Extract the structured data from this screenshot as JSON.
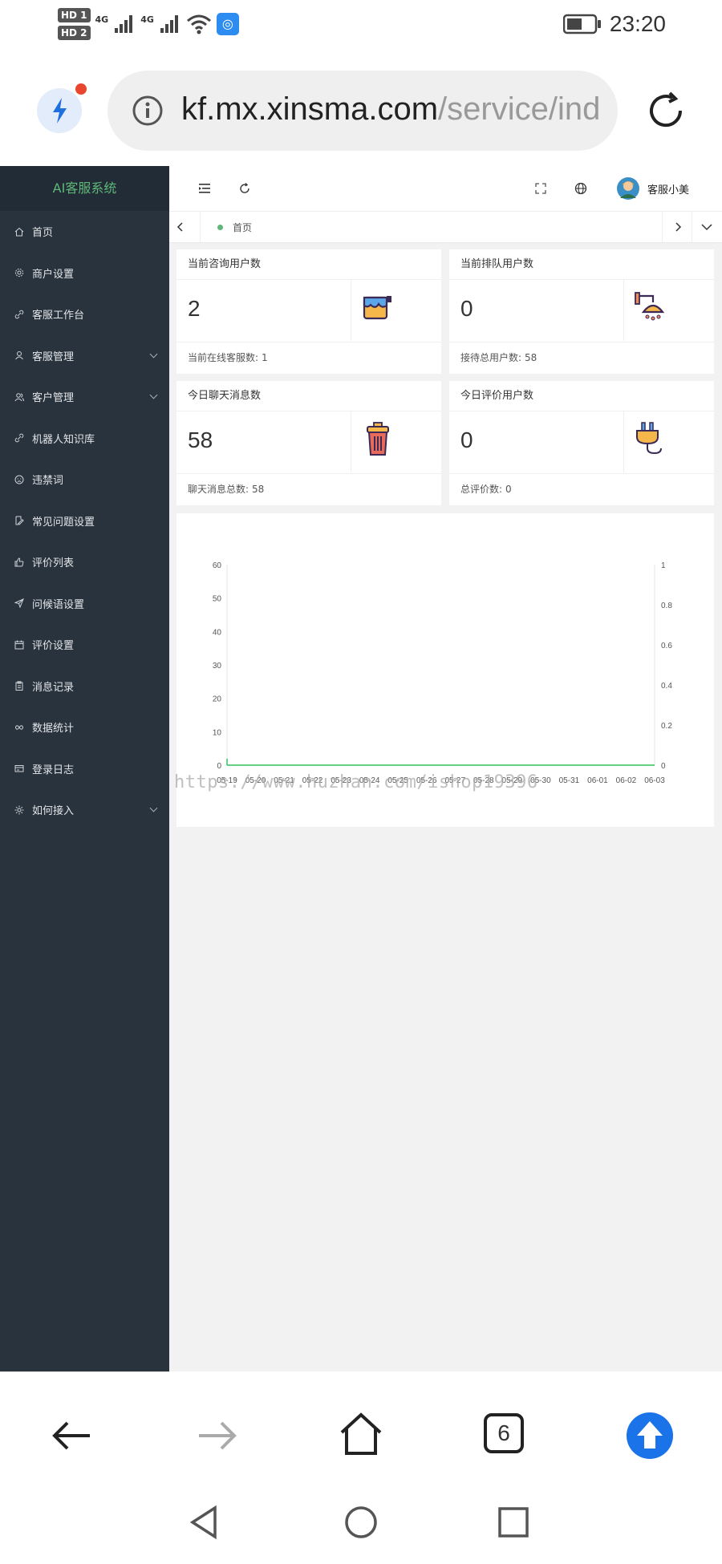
{
  "status_bar": {
    "sim1": "HD 1",
    "sim2": "HD 2",
    "net1": "4G",
    "net2": "4G",
    "time": "23:20"
  },
  "browser": {
    "url_host": "kf.mx.xinsma.com",
    "url_path": "/service/ind",
    "tab_count": "6"
  },
  "sidebar": {
    "title": "AI客服系统",
    "items": [
      {
        "label": "首页",
        "icon": "home-icon"
      },
      {
        "label": "商户设置",
        "icon": "gear-icon"
      },
      {
        "label": "客服工作台",
        "icon": "link-icon"
      },
      {
        "label": "客服管理",
        "icon": "user-icon"
      },
      {
        "label": "客户管理",
        "icon": "users-icon"
      },
      {
        "label": "机器人知识库",
        "icon": "link-icon"
      },
      {
        "label": "违禁词",
        "icon": "face-icon"
      },
      {
        "label": "常见问题设置",
        "icon": "doc-edit-icon"
      },
      {
        "label": "评价列表",
        "icon": "thumb-up-icon"
      },
      {
        "label": "问候语设置",
        "icon": "send-icon"
      },
      {
        "label": "评价设置",
        "icon": "calendar-icon"
      },
      {
        "label": "消息记录",
        "icon": "clipboard-icon"
      },
      {
        "label": "数据统计",
        "icon": "infinity-icon"
      },
      {
        "label": "登录日志",
        "icon": "card-icon"
      },
      {
        "label": "如何接入",
        "icon": "settings-icon"
      }
    ]
  },
  "header": {
    "username": "客服小美"
  },
  "tabs": {
    "home": "首页"
  },
  "cards": [
    {
      "title": "当前咨询用户数",
      "value": "2",
      "foot_label": "当前在线客服数:",
      "foot_value": "1"
    },
    {
      "title": "当前排队用户数",
      "value": "0",
      "foot_label": "接待总用户数:",
      "foot_value": "58"
    },
    {
      "title": "今日聊天消息数",
      "value": "58",
      "foot_label": "聊天消息总数:",
      "foot_value": "58"
    },
    {
      "title": "今日评价用户数",
      "value": "0",
      "foot_label": "总评价数:",
      "foot_value": "0"
    }
  ],
  "watermark": "https://www.huzhan.com/ishop19396",
  "chart_data": {
    "type": "line",
    "x": [
      "05-19",
      "05-20",
      "05-21",
      "05-22",
      "05-23",
      "05-24",
      "05-25",
      "05-26",
      "05-27",
      "05-28",
      "05-29",
      "05-30",
      "05-31",
      "06-01",
      "06-02",
      "06-03"
    ],
    "series": [
      {
        "values": [
          0,
          0,
          0,
          0,
          0,
          0,
          0,
          0,
          0,
          0,
          0,
          0,
          0,
          0,
          0,
          0
        ]
      }
    ],
    "y_left_ticks": [
      "0",
      "10",
      "20",
      "30",
      "40",
      "50",
      "60"
    ],
    "y_right_ticks": [
      "0",
      "0.2",
      "0.4",
      "0.6",
      "0.8",
      "1"
    ],
    "ylim_left": [
      0,
      60
    ],
    "ylim_right": [
      0,
      1
    ],
    "grid": false,
    "colors": {
      "line": "#2fc25b"
    }
  }
}
